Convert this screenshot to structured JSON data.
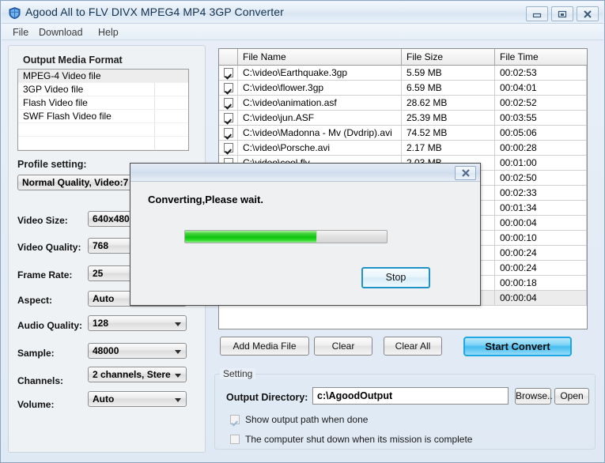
{
  "window": {
    "title": "Agood All to FLV DIVX MPEG4 MP4 3GP Converter",
    "app_icon": "shield-icon",
    "minimize_label": "",
    "maximize_label": "",
    "close_label": ""
  },
  "menu": {
    "items": [
      {
        "label": "File"
      },
      {
        "label": "Download"
      },
      {
        "label": "Help"
      }
    ]
  },
  "left_panel": {
    "output_media_format": {
      "title": "Output Media Format",
      "items": [
        {
          "label": "MPEG-4 Video file",
          "selected": true
        },
        {
          "label": "3GP Video file",
          "selected": false
        },
        {
          "label": "Flash Video file",
          "selected": false
        },
        {
          "label": "SWF Flash Video file",
          "selected": false
        }
      ]
    },
    "profile_setting": {
      "title": "Profile setting:",
      "value": "Normal Quality, Video:7"
    },
    "fields": [
      {
        "label": "Video Size:",
        "value": "640x480"
      },
      {
        "label": "Video Quality:",
        "value": "768"
      },
      {
        "label": "Frame Rate:",
        "value": "25"
      },
      {
        "label": "Aspect:",
        "value": "Auto"
      },
      {
        "label": "Audio Quality:",
        "value": "128"
      },
      {
        "label": "Sample:",
        "value": "48000"
      },
      {
        "label": "Channels:",
        "value": "2 channels, Stere"
      },
      {
        "label": "Volume:",
        "value": "Auto"
      }
    ]
  },
  "file_list": {
    "columns": [
      "",
      "File Name",
      "File Size",
      "File Time"
    ],
    "rows": [
      {
        "checked": true,
        "name": "C:\\video\\Earthquake.3gp",
        "size": "5.59 MB",
        "time": "00:02:53"
      },
      {
        "checked": true,
        "name": "C:\\video\\flower.3gp",
        "size": "6.59 MB",
        "time": "00:04:01"
      },
      {
        "checked": true,
        "name": "C:\\video\\animation.asf",
        "size": "28.62 MB",
        "time": "00:02:52"
      },
      {
        "checked": true,
        "name": "C:\\video\\jun.ASF",
        "size": "25.39 MB",
        "time": "00:03:55"
      },
      {
        "checked": true,
        "name": "C:\\video\\Madonna - Mv (Dvdrip).avi",
        "size": "74.52 MB",
        "time": "00:05:06"
      },
      {
        "checked": true,
        "name": "C:\\video\\Porsche.avi",
        "size": "2.17 MB",
        "time": "00:00:28"
      },
      {
        "checked": true,
        "name": "C:\\video\\cool.flv",
        "size": "2.03 MB",
        "time": "00:01:00"
      },
      {
        "checked": true,
        "name": "",
        "size": "",
        "time": "00:02:50"
      },
      {
        "checked": true,
        "name": "",
        "size": "",
        "time": "00:02:33"
      },
      {
        "checked": true,
        "name": "",
        "size": "",
        "time": "00:01:34"
      },
      {
        "checked": true,
        "name": "",
        "size": "",
        "time": "00:00:04"
      },
      {
        "checked": true,
        "name": "",
        "size": "",
        "time": "00:00:10"
      },
      {
        "checked": true,
        "name": "",
        "size": "",
        "time": "00:00:24"
      },
      {
        "checked": true,
        "name": "",
        "size": "",
        "time": "00:00:24"
      },
      {
        "checked": true,
        "name": "",
        "size": "",
        "time": "00:00:18"
      },
      {
        "checked": true,
        "name": "",
        "size": "",
        "time": "00:00:04"
      }
    ]
  },
  "actions": {
    "add_media_file": "Add Media File",
    "clear": "Clear",
    "clear_all": "Clear All",
    "start_convert": "Start Convert"
  },
  "setting": {
    "group_label": "Setting",
    "output_directory_label": "Output Directory:",
    "output_directory_value": "c:\\AgoodOutput",
    "browse_label": "Browse..",
    "open_label": "Open",
    "checkbox_show_output": {
      "label": "Show output path when done",
      "checked": true
    },
    "checkbox_shutdown": {
      "label": "The computer shut down when its mission is complete",
      "checked": false
    }
  },
  "dialog": {
    "message": "Converting,Please wait.",
    "progress_percent": 65,
    "stop_label": "Stop",
    "close_icon": "close-icon"
  },
  "colors": {
    "accent_blue": "#45bdf0",
    "progress_green": "#0ec40e",
    "window_bg": "#e9eff6"
  }
}
